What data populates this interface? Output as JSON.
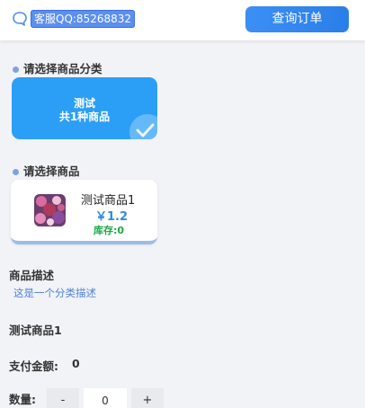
{
  "header": {
    "service_text": "客服QQ:85268832",
    "query_button": "查询订单",
    "service_icon": "chat-bubble-icon"
  },
  "category_section": {
    "title": "请选择商品分类",
    "categories": [
      {
        "name": "测试",
        "count_text": "共1种商品",
        "selected": true
      }
    ]
  },
  "goods_section": {
    "title": "请选择商品",
    "items": [
      {
        "name": "测试商品1",
        "price": "￥1.2",
        "stock": "库存:0",
        "thumbnail_icon": "product-thumbnail"
      }
    ]
  },
  "description": {
    "label": "商品描述",
    "text": "这是一个分类描述"
  },
  "selected_goods_name": "测试商品1",
  "payment": {
    "label": "支付金额:",
    "amount": "0"
  },
  "quantity": {
    "label": "数量:",
    "minus": "-",
    "value": "0",
    "plus": "+"
  },
  "colors": {
    "accent": "#2b9ff6",
    "price": "#2f8be6",
    "stock": "#1ea64b",
    "background": "#f2f3f7"
  }
}
